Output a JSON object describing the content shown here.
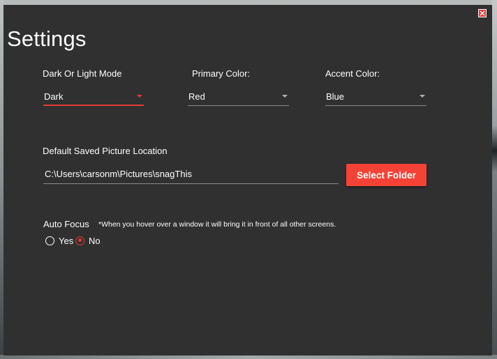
{
  "window": {
    "title": "Settings",
    "close_icon": "close-icon"
  },
  "theme_mode": {
    "label": "Dark Or Light Mode",
    "value": "Dark"
  },
  "primary_color": {
    "label": "Primary Color:",
    "value": "Red"
  },
  "accent_color": {
    "label": "Accent Color:",
    "value": "Blue"
  },
  "save_location": {
    "label": "Default Saved Picture Location",
    "value": "C:\\Users\\carsonm\\Pictures\\snagThis",
    "button_label": "Select Folder"
  },
  "auto_focus": {
    "label": "Auto Focus",
    "note": "*When you hover over a window it will bring it in front of all other screens.",
    "options": [
      {
        "label": "Yes",
        "selected": false
      },
      {
        "label": "No",
        "selected": true
      }
    ]
  },
  "colors": {
    "accent": "#f44336",
    "window_bg": "#303030",
    "text": "#ffffff"
  }
}
